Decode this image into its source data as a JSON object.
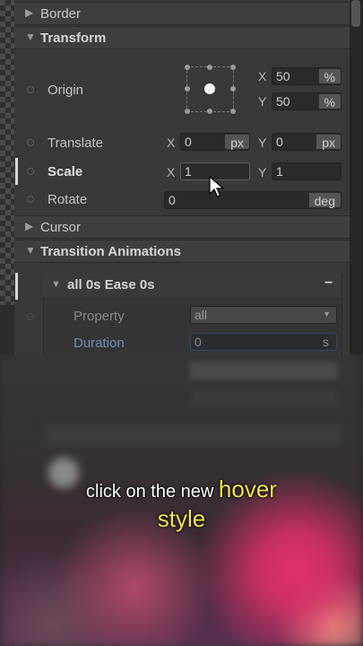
{
  "sections": {
    "border": "Border",
    "transform": "Transform",
    "cursor": "Cursor",
    "transition_animations": "Transition Animations"
  },
  "transform": {
    "origin": {
      "label": "Origin",
      "x_axis": "X",
      "x_value": "50",
      "x_unit": "%",
      "y_axis": "Y",
      "y_value": "50",
      "y_unit": "%"
    },
    "translate": {
      "label": "Translate",
      "x_axis": "X",
      "x_value": "0",
      "x_unit": "px",
      "y_axis": "Y",
      "y_value": "0",
      "y_unit": "px"
    },
    "scale": {
      "label": "Scale",
      "x_axis": "X",
      "x_value": "1",
      "y_axis": "Y",
      "y_value": "1"
    },
    "rotate": {
      "label": "Rotate",
      "value": "0",
      "unit": "deg"
    }
  },
  "transition": {
    "item_title": "all 0s Ease 0s",
    "remove_label": "−",
    "property_label": "Property",
    "property_value": "all",
    "duration_label": "Duration",
    "duration_value": "0",
    "duration_unit": "s"
  },
  "caption": {
    "prefix": "click on the new ",
    "highlight1": "hover",
    "highlight2": "style"
  }
}
